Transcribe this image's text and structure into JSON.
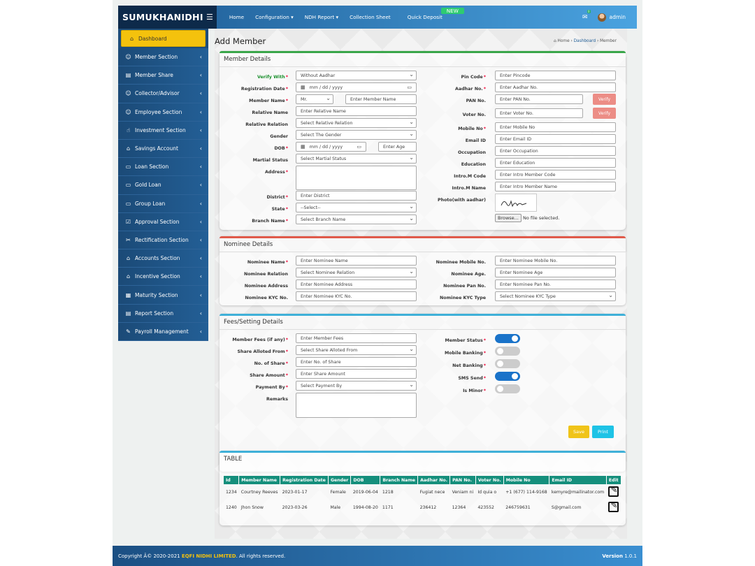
{
  "brand": {
    "name": "SUMUKHANIDHI L'",
    "menu_icon": "hamburger-icon"
  },
  "nav": {
    "home": "Home",
    "configuration": "Configuration ▾",
    "ndh_report": "NDH Report ▾",
    "collection_sheet": "Collection Sheet",
    "quick_deposit": "Quick Deposit",
    "new_badge": "NEW"
  },
  "user": {
    "name": "admin",
    "mail_count": "0"
  },
  "sidebar": {
    "items": [
      {
        "label": "Dashboard",
        "icon": "dashboard-icon"
      },
      {
        "label": "Member Section",
        "icon": "user-icon"
      },
      {
        "label": "Member Share",
        "icon": "document-icon"
      },
      {
        "label": "Collector/Advisor",
        "icon": "user-icon"
      },
      {
        "label": "Employee Section",
        "icon": "user-icon"
      },
      {
        "label": "Investment Section",
        "icon": "hand-icon"
      },
      {
        "label": "Savings Account",
        "icon": "bank-icon"
      },
      {
        "label": "Loan Section",
        "icon": "money-icon"
      },
      {
        "label": "Gold Loan",
        "icon": "money-icon"
      },
      {
        "label": "Group Loan",
        "icon": "money-icon"
      },
      {
        "label": "Approval Section",
        "icon": "check-icon"
      },
      {
        "label": "Rectification Section",
        "icon": "tools-icon"
      },
      {
        "label": "Accounts Section",
        "icon": "bank-icon"
      },
      {
        "label": "Incentive Section",
        "icon": "bank-icon"
      },
      {
        "label": "Maturity Section",
        "icon": "calculator-icon"
      },
      {
        "label": "Report Section",
        "icon": "report-icon"
      },
      {
        "label": "Payroll Management",
        "icon": "payroll-icon"
      }
    ]
  },
  "page": {
    "title": "Add Member",
    "crumb_home": "Home",
    "crumb_dash": "Dashboard",
    "crumb_current": "Member"
  },
  "member": {
    "title": "Member Details",
    "verify_with_label": "Verify With",
    "verify_with_value": "Without Aadhar",
    "reg_date_label": "Registration Date",
    "reg_date_ph": "mm / dd / yyyy",
    "member_name_label": "Member Name",
    "salutation": "Mr.",
    "member_name_ph": "Enter Member Name",
    "relative_name_label": "Relative Name",
    "relative_name_ph": "Enter Relative Name",
    "relative_relation_label": "Relative Relation",
    "relative_relation_ph": "Select Relative Relation",
    "gender_label": "Gender",
    "gender_ph": "Select The Gender",
    "dob_label": "DOB",
    "dob_ph": "mm / dd / yyyy",
    "age_ph": "Enter Age",
    "marital_label": "Martial Status",
    "marital_ph": "Select Martial Status",
    "address_label": "Address",
    "district_label": "District",
    "district_ph": "Enter District",
    "state_label": "State",
    "state_ph": "--Select--",
    "branch_label": "Branch Name",
    "branch_ph": "Select Branch Name",
    "pin_label": "Pin Code",
    "pin_ph": "Enter Pincode",
    "aadhar_label": "Aadhar No.",
    "aadhar_ph": "Enter Aadhar No.",
    "pan_label": "PAN No.",
    "pan_ph": "Enter PAN No.",
    "voter_label": "Voter No.",
    "voter_ph": "Enter Voter No.",
    "verify_btn": "Verify",
    "mobile_label": "Mobile No",
    "mobile_ph": "Enter Mobile No",
    "email_label": "Email ID",
    "email_ph": "Enter Email ID",
    "occupation_label": "Occupation",
    "occupation_ph": "Enter Occupation",
    "education_label": "Education",
    "education_ph": "Enter Education",
    "intro_code_label": "Intro.M Code",
    "intro_code_ph": "Enter Intro Member Code",
    "intro_name_label": "Intro.M Name",
    "intro_name_ph": "Enter Intro Member Name",
    "photo_label": "Photo(with aadhar)",
    "browse_btn": "Browse...",
    "no_file": "No file selected."
  },
  "nominee": {
    "title": "Nominee Details",
    "name_label": "Nominee Name",
    "name_ph": "Enter Nominee Name",
    "relation_label": "Nominee Relation",
    "relation_ph": "Select Nominee Relation",
    "address_label": "Nominee Address",
    "address_ph": "Enter Nominee Address",
    "kyc_no_label": "Nominee KYC No.",
    "kyc_no_ph": "Enter Nominee KYC No.",
    "mobile_label": "Nominee Mobile No.",
    "mobile_ph": "Enter Nominee Mobile No.",
    "age_label": "Nominee Age.",
    "age_ph": "Enter Nominee Age",
    "pan_label": "Nominee Pan No.",
    "pan_ph": "Enter Nominee Pan No.",
    "kyc_type_label": "Nominee KYC Type",
    "kyc_type_ph": "Select Nominee KYC Type"
  },
  "fees": {
    "title": "Fees/Setting Details",
    "member_fees_label": "Member Fees (if any)",
    "member_fees_ph": "Enter Member Fees",
    "share_from_label": "Share Alloted From",
    "share_from_ph": "Select Share Alloted From",
    "share_no_label": "No. of Share",
    "share_no_ph": "Enter No. of Share",
    "share_amount_label": "Share Amount",
    "share_amount_ph": "Enter Share Amount",
    "payment_label": "Payment By",
    "payment_ph": "Select Payment By",
    "remarks_label": "Remarks",
    "member_status_label": "Member Status",
    "mobile_banking_label": "Mobile Banking",
    "net_banking_label": "Net Banking",
    "sms_label": "SMS Send",
    "minor_label": "Is Minor",
    "member_status_on": true,
    "mobile_banking_on": false,
    "net_banking_on": false,
    "sms_on": true,
    "minor_on": false,
    "save_btn": "Save",
    "print_btn": "Print"
  },
  "table": {
    "title": "TABLE",
    "headers": [
      "Id",
      "Member Name",
      "Registration Date",
      "Gender",
      "DOB",
      "Branch Name",
      "Aadhar No.",
      "PAN No.",
      "Voter No.",
      "Mobile No",
      "Email ID",
      "Edit"
    ],
    "rows": [
      [
        "1234",
        "Courtney Reeves",
        "2023-01-17",
        "Female",
        "2019-06-04",
        "1218",
        "Fugiat nece",
        "Veniam ni",
        "Id quia o",
        "+1 (677) 114-9168",
        "kemyre@mailinator.com"
      ],
      [
        "1240",
        "Jhon Snow",
        "2023-03-26",
        "Male",
        "1994-08-20",
        "1171",
        "236412",
        "12364",
        "423552",
        "246759631",
        "S@gmail.com"
      ]
    ]
  },
  "footer": {
    "prefix": "Copyright Â© 2020-2021 ",
    "company": "EQFI NIDHI LIMITED",
    "suffix": ". All rights reserved.",
    "version_label": "Version",
    "version": "1.0.1"
  },
  "colors": {
    "member_bar": "#3aa64a",
    "nominee_bar": "#e05a4a",
    "fees_bar": "#3fb0d8",
    "table_bar": "#3fb0d8",
    "save": "#f0c419",
    "print": "#1ec3e6"
  }
}
